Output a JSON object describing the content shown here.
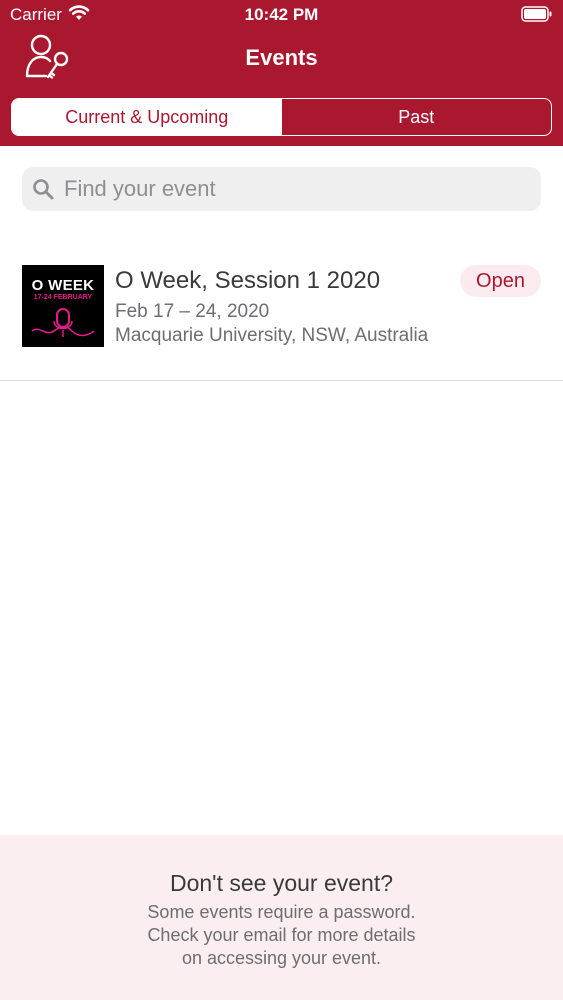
{
  "status_bar": {
    "carrier": "Carrier",
    "time": "10:42 PM"
  },
  "header": {
    "title": "Events",
    "login_icon": "user-key-icon",
    "background_color": "#a9182f"
  },
  "tabs": [
    {
      "label": "Current & Upcoming",
      "selected": true
    },
    {
      "label": "Past",
      "selected": false
    }
  ],
  "search": {
    "placeholder": "Find your event",
    "value": ""
  },
  "events": [
    {
      "name": "O Week, Session 1 2020",
      "date": "Feb 17 – 24, 2020",
      "location": "Macquarie University, NSW, Australia",
      "status": "Open",
      "thumbnail": {
        "title": "O WEEK",
        "subtitle": "17-24 FEBRUARY"
      }
    }
  ],
  "footer": {
    "title": "Don't see your event?",
    "text": "Some events require a password.\nCheck your email for more details\non accessing your event."
  }
}
